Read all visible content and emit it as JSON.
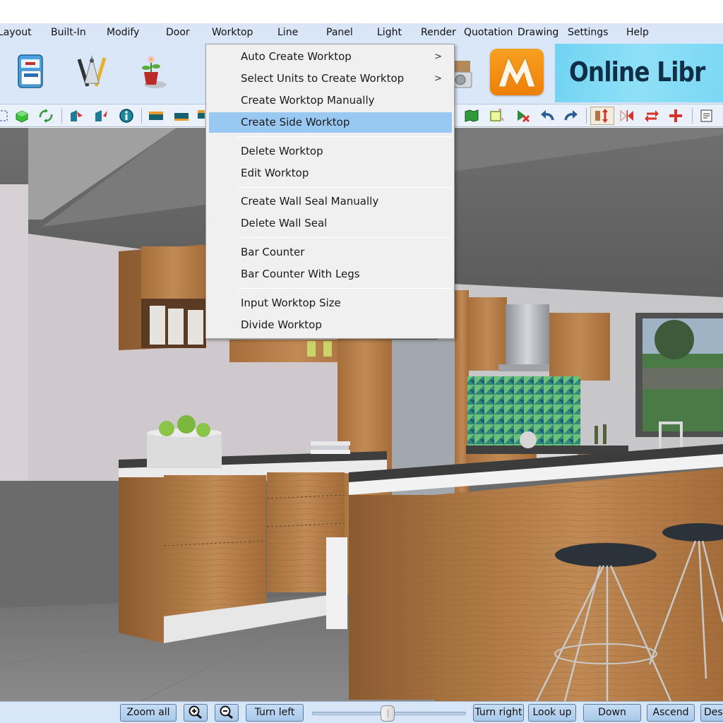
{
  "menubar": {
    "items": [
      {
        "label": "Layout"
      },
      {
        "label": "Built-In"
      },
      {
        "label": "Modify"
      },
      {
        "label": "Door"
      },
      {
        "label": "Worktop"
      },
      {
        "label": "Line"
      },
      {
        "label": "Panel"
      },
      {
        "label": "Light"
      },
      {
        "label": "Render"
      },
      {
        "label": "Quotation"
      },
      {
        "label": "Drawing"
      },
      {
        "label": "Settings"
      },
      {
        "label": "Help"
      }
    ],
    "active": "Worktop"
  },
  "bigtoolbar": {
    "icons": [
      "cabinet-drawer-icon",
      "drafting-compass-icon",
      "plant-pot-icon",
      "camera-icon"
    ],
    "logo_letter": "M",
    "online_library_label": "Online Libr"
  },
  "smalltoolbar": {
    "icons": [
      "select-box-icon",
      "green-cube-icon",
      "rotate-arrows-icon",
      "door-in-icon",
      "door-out-icon",
      "info-icon",
      "panel-top-icon",
      "panel-icon",
      "panel-side-icon",
      "wall-map-icon",
      "resize-box-icon",
      "delete-select-icon",
      "undo-icon",
      "redo-icon",
      "flip-vertical-icon",
      "mirror-icon",
      "swap-icon",
      "move-icon",
      "notes-icon"
    ]
  },
  "worktop_menu": {
    "groups": [
      [
        {
          "label": "Auto Create Worktop",
          "submenu": true
        },
        {
          "label": "Select Units to Create Worktop",
          "submenu": true
        },
        {
          "label": "Create Worktop Manually",
          "submenu": false
        },
        {
          "label": "Create Side Worktop",
          "submenu": false,
          "highlighted": true
        }
      ],
      [
        {
          "label": "Delete Worktop",
          "submenu": false
        },
        {
          "label": "Edit Worktop",
          "submenu": false
        }
      ],
      [
        {
          "label": "Create Wall Seal Manually",
          "submenu": false
        },
        {
          "label": "Delete Wall Seal",
          "submenu": false
        }
      ],
      [
        {
          "label": "Bar Counter",
          "submenu": false
        },
        {
          "label": "Bar Counter With Legs",
          "submenu": false
        }
      ],
      [
        {
          "label": "Input Worktop Size",
          "submenu": false
        },
        {
          "label": "Divide Worktop",
          "submenu": false
        }
      ]
    ],
    "submenu_arrow": ">"
  },
  "navbar": {
    "zoom_all": "Zoom all",
    "zoom_in_icon": "zoom-in-icon",
    "zoom_out_icon": "zoom-out-icon",
    "turn_left": "Turn left",
    "turn_right": "Turn right",
    "look_up": "Look up",
    "down": "Down",
    "ascend": "Ascend",
    "descend": "Des",
    "slider_value_fraction": 0.49
  },
  "colors": {
    "menu_highlight": "#99c9f3",
    "toolbar_bg": "#d9e7f8",
    "logo_orange": "#f08a12",
    "library_cyan": "#7ad8f4"
  }
}
